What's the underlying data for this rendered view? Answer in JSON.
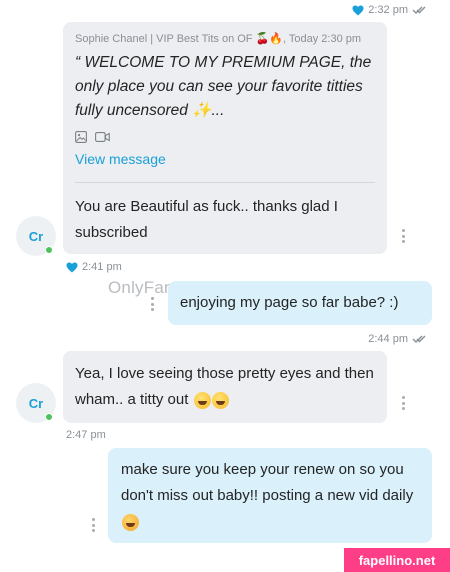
{
  "messages": [
    {
      "kind": "meta-outgoing",
      "time": "2:32 pm"
    },
    {
      "kind": "incoming-with-quote",
      "quote": {
        "sender_line": "Sophie Chanel | VIP Best Tits on OF 🍒🔥, Today 2:30 pm",
        "text": "“ WELCOME TO MY PREMIUM PAGE, the only place you can see your favorite titties fully uncensored ✨...",
        "view_label": "View message"
      },
      "text": "You are Beautiful as fuck.. thanks glad I subscribed",
      "avatar": "Cr",
      "time": "2:41 pm"
    },
    {
      "kind": "outgoing",
      "text": "enjoying my page so far babe? :)",
      "time": "2:44 pm"
    },
    {
      "kind": "incoming",
      "text": "Yea, I love seeing those pretty eyes and then wham.. a titty out",
      "avatar": "Cr",
      "time": "2:47 pm"
    },
    {
      "kind": "outgoing",
      "text": "make sure you keep your renew on so you don't miss out baby!! posting a new vid daily"
    }
  ],
  "watermark": "OnlyFans.com/@nobettertits",
  "brand": "fapellino.net",
  "colors": {
    "accent": "#1aa0d8",
    "incoming_bubble": "#eceef1",
    "outgoing_bubble": "#daf1fb",
    "online": "#4cc35b",
    "brand_bg": "#ff3e88"
  }
}
